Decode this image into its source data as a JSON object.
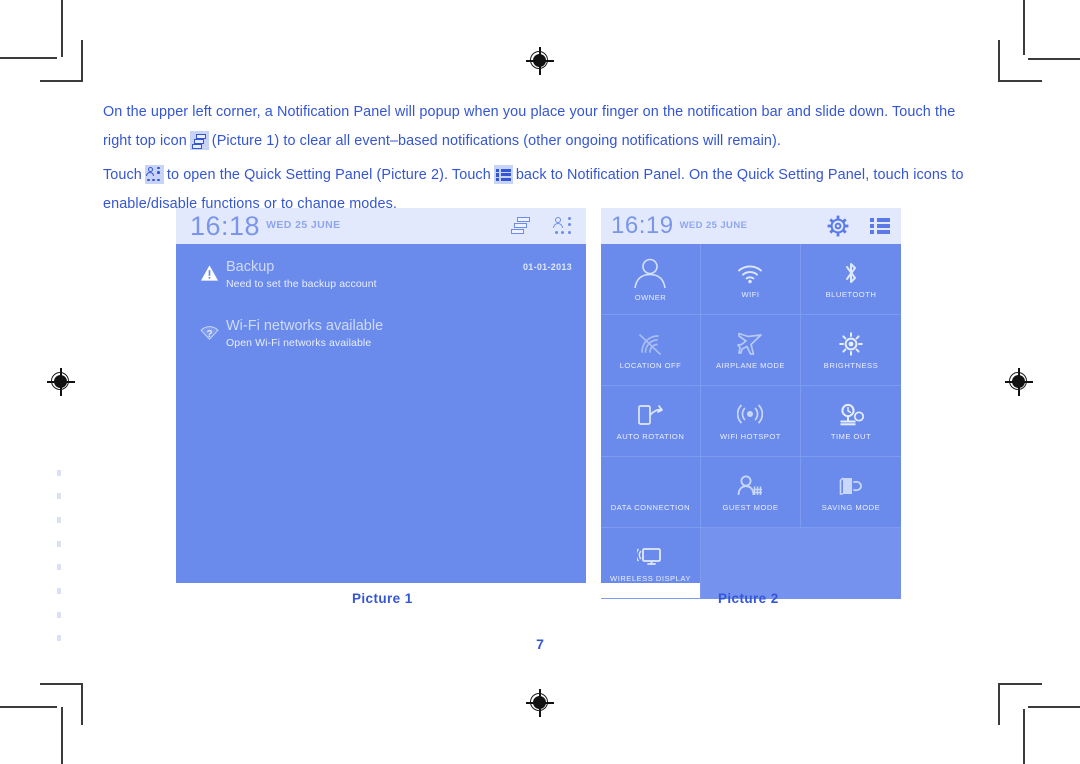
{
  "document": {
    "page_number": "7",
    "paragraphs": [
      {
        "seg1": "On the upper left corner, a Notification Panel will popup when you place your finger on the notification bar and slide down. Touch the right top icon",
        "icon1": "clear-all-icon",
        "seg2": "(Picture 1) to clear all event–based notifications (other ongoing notifications will remain)."
      },
      {
        "seg1": "Touch",
        "icon1": "quick-settings-icon",
        "seg2": "to open the Quick Setting Panel (Picture 2). Touch",
        "icon2": "list-menu-icon",
        "seg3": "back to Notification Panel. On the Quick Setting Panel, touch icons to enable/disable functions or to change modes."
      }
    ],
    "captions": {
      "picture1": "Picture 1",
      "picture2": "Picture 2"
    }
  },
  "colors": {
    "text_blue": "#3556d4",
    "panel_blue": "#6b8bec",
    "statusbar_blue": "#e2e9fd",
    "tile_divider": "#7e9bf0",
    "icon_blue": "#6e8cec"
  },
  "picture1": {
    "name": "notification-panel",
    "statusbar": {
      "time": "16:18",
      "date": "WED 25 JUNE",
      "icons": [
        "clear-all-icon",
        "quick-settings-icon"
      ]
    },
    "notifications": [
      {
        "icon": "warning-triangle-icon",
        "title": "Backup",
        "subtitle": "Need to set the backup account",
        "time": "01-01-2013"
      },
      {
        "icon": "wifi-question-icon",
        "title": "Wi-Fi networks available",
        "subtitle": "Open Wi-Fi networks available",
        "time": ""
      }
    ]
  },
  "picture2": {
    "name": "quick-settings-panel",
    "statusbar": {
      "time": "16:19",
      "date": "WED 25 JUNE",
      "icons": [
        "gear-icon",
        "list-menu-icon"
      ]
    },
    "tiles": [
      {
        "label": "OWNER",
        "icon": "user-avatar-icon"
      },
      {
        "label": "WIFI",
        "icon": "wifi-icon"
      },
      {
        "label": "BLUETOOTH",
        "icon": "bluetooth-icon"
      },
      {
        "label": "LOCATION OFF",
        "icon": "location-off-icon"
      },
      {
        "label": "AIRPLANE MODE",
        "icon": "airplane-icon"
      },
      {
        "label": "BRIGHTNESS",
        "icon": "brightness-sun-icon"
      },
      {
        "label": "AUTO ROTATION",
        "icon": "auto-rotation-icon"
      },
      {
        "label": "WIFI HOTSPOT",
        "icon": "hotspot-icon"
      },
      {
        "label": "TIME OUT",
        "icon": "timeout-icon"
      },
      {
        "label": "DATA CONNECTION",
        "icon": "data-connection-icon"
      },
      {
        "label": "GUEST MODE",
        "icon": "guest-mode-icon"
      },
      {
        "label": "SAVING MODE",
        "icon": "saving-mode-icon"
      },
      {
        "label": "WIRELESS DISPLAY",
        "icon": "wireless-display-icon"
      }
    ]
  }
}
